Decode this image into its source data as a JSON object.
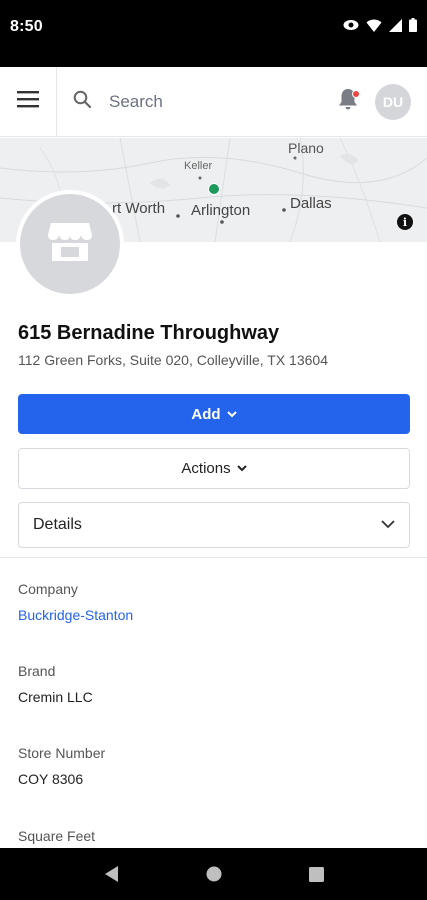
{
  "status_bar": {
    "time": "8:50"
  },
  "header": {
    "search_placeholder": "Search",
    "avatar_initials": "DU"
  },
  "map": {
    "labels": {
      "plano": "Plano",
      "keller": "Keller",
      "fort_worth": "rt Worth",
      "arlington": "Arlington",
      "dallas": "Dallas"
    },
    "info_glyph": "i"
  },
  "store": {
    "name": "615 Bernadine Throughway",
    "address": "112 Green Forks, Suite 020, Colleyville, TX 13604"
  },
  "buttons": {
    "add_label": "Add",
    "actions_label": "Actions"
  },
  "details": {
    "selected": "Details"
  },
  "fields": [
    {
      "label": "Company",
      "value": "Buckridge-Stanton"
    },
    {
      "label": "Brand",
      "value": "Cremin LLC"
    },
    {
      "label": "Store Number",
      "value": "COY 8306"
    },
    {
      "label": "Square Feet",
      "value": ""
    }
  ],
  "colors": {
    "primary": "#2463eb",
    "map_pin": "#1d9a5b",
    "notification_dot": "#ef4444"
  }
}
